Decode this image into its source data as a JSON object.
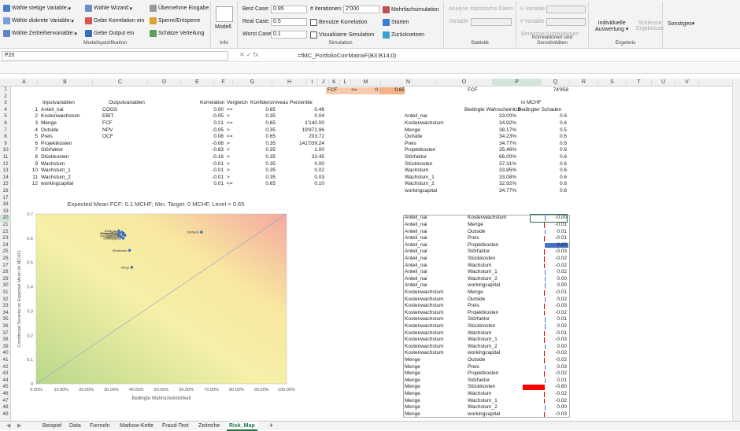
{
  "ribbon": {
    "modell": {
      "stetige": "Wähle stetige Variable:",
      "diskrete": "Wähle diskrete Variable:",
      "zeitreihe": "Wähle Zeitreihenvariable:",
      "wizard": "Wähle Wizard:",
      "korrelation": "Gebe Korrelation ein",
      "output": "Gebe Output ein",
      "uebernehme": "Übernehme Eingabe",
      "sperre": "Sperre/Entsperre",
      "schaetze": "Schätze Verteilung",
      "group_label": "Modellspezifikation"
    },
    "info": {
      "modell": "Modell",
      "group_label": "Info"
    },
    "simulation": {
      "best_label": "Best Case:",
      "best_value": "0.95",
      "real_label": "Real Case:",
      "real_value": "0.5",
      "worst_label": "Worst Case:",
      "worst_value": "0.1",
      "iter_label": "# Iterationen:",
      "iter_value": "2'000",
      "benutze": "Benutze Korrelation",
      "visualisiere": "Visualisiere Simulation",
      "mehrfach": "Mehrfachsimulation",
      "starten": "Starten",
      "zurueck": "Zurücksetzen",
      "group_label": "Simulation"
    },
    "statistik": {
      "analyse": "Analyse statistische Daten",
      "variable": "Variable",
      "group_label": "Statistik"
    },
    "korr": {
      "xvar": "X-Variable",
      "yvar": "Y-Variable",
      "berechne": "Berechne Korrelationen",
      "group_label": "Korrelationen und Sensitivitäten"
    },
    "ergebnis": {
      "individuelle": "Individuelle",
      "auswertung": "Auswertung",
      "schliesse": "Schliesse",
      "ergebnisse": "Ergebnisse",
      "group_label": "Ergebnis"
    },
    "sonstiges": {
      "label": "Sonstiges"
    }
  },
  "formula": {
    "namebox": "P20",
    "fx": "fx",
    "content": "=fMC_PortfolioCorrMatrixF(B3:B14;0)"
  },
  "columns": [
    "A",
    "B",
    "C",
    "D",
    "E",
    "F",
    "G",
    "H",
    "I",
    "J",
    "K",
    "L",
    "M",
    "N",
    "O",
    "P",
    "Q",
    "R",
    "S",
    "T",
    "U",
    "V"
  ],
  "rows": [
    "1",
    "2",
    "3",
    "4",
    "5",
    "6",
    "7",
    "8",
    "9",
    "10",
    "11",
    "12",
    "13",
    "14",
    "15",
    "16",
    "17",
    "18",
    "19",
    "20",
    "21",
    "22",
    "23",
    "24",
    "25",
    "26",
    "27",
    "28",
    "29",
    "30",
    "31",
    "32",
    "33",
    "34",
    "35",
    "36",
    "37",
    "38",
    "39",
    "40",
    "41",
    "42",
    "43",
    "44",
    "45",
    "46",
    "47",
    "48",
    "49"
  ],
  "fcf_box": {
    "label": "FCF",
    "op": "<=",
    "value": "0",
    "m": "0.65"
  },
  "table1": {
    "headers": [
      "Inputvariablen",
      "Outputvariablen",
      "Korrelation",
      "Vergleich",
      "Konfidenzniveau",
      "Perzentile"
    ],
    "rows": [
      [
        "1",
        "Anteil_nai",
        "COGS",
        "0.00",
        "<=",
        "0.65",
        "0.46"
      ],
      [
        "2",
        "Kostenwachstum",
        "EBIT",
        "-0.05",
        ">",
        "0.35",
        "0.04"
      ],
      [
        "3",
        "Menge",
        "FCF",
        "0.21",
        "<=",
        "0.65",
        "1'140.00"
      ],
      [
        "4",
        "Outside",
        "NPV",
        "-0.05",
        ">",
        "0.35",
        "19'872.96"
      ],
      [
        "5",
        "Preis",
        "OCF",
        "0.08",
        "<=",
        "0.65",
        "203.72"
      ],
      [
        "6",
        "Projektkosten",
        "",
        "-0.06",
        ">",
        "0.35",
        "141'039.24"
      ],
      [
        "7",
        "Störfaktor",
        "",
        "-0.83",
        ">",
        "0.35",
        "1.00"
      ],
      [
        "8",
        "Stückkosten",
        "",
        "-0.16",
        ">",
        "0.35",
        "33.45"
      ],
      [
        "9",
        "Wachstum",
        "",
        "-0.01",
        ">",
        "0.35",
        "0.00"
      ],
      [
        "10",
        "Wachstum_1",
        "",
        "-0.01",
        ">",
        "0.35",
        "0.02"
      ],
      [
        "11",
        "Wachstum_2",
        "",
        "-0.01",
        ">",
        "0.35",
        "0.03"
      ],
      [
        "12",
        "workingcapital",
        "",
        "0.01",
        "<=",
        "0.65",
        "0.10"
      ]
    ]
  },
  "table2": {
    "fcf_label": "FCF",
    "fcf_value": "74'958",
    "unit": "in MCHF",
    "h1": "Bedingte Wahrscheinlich",
    "h2": "Bedingter Schaden",
    "rows": [
      [
        "Anteil_nai",
        "33.00%",
        "0.6"
      ],
      [
        "Kostenwachstum",
        "34.92%",
        "0.6"
      ],
      [
        "Menge",
        "38.17%",
        "0.5"
      ],
      [
        "Outside",
        "34.23%",
        "0.6"
      ],
      [
        "Preis",
        "34.77%",
        "0.6"
      ],
      [
        "Projektkosten",
        "35.46%",
        "0.6"
      ],
      [
        "Störfaktor",
        "66.00%",
        "0.6"
      ],
      [
        "Stückkosten",
        "37.31%",
        "0.6"
      ],
      [
        "Wachstum",
        "33.85%",
        "0.6"
      ],
      [
        "Wachstum_1",
        "33.08%",
        "0.6"
      ],
      [
        "Wachstum_2",
        "32.92%",
        "0.6"
      ],
      [
        "workingcapital",
        "34.77%",
        "0.6"
      ]
    ]
  },
  "corr_list": [
    [
      "Anteil_nai",
      "Kostenwachstum",
      "-0.00"
    ],
    [
      "Anteil_nai",
      "Menge",
      "-0.01"
    ],
    [
      "Anteil_nai",
      "Outside",
      "0.01"
    ],
    [
      "Anteil_nai",
      "Preis",
      "-0.01"
    ],
    [
      "Anteil_nai",
      "Projektkosten",
      "0.65"
    ],
    [
      "Anteil_nai",
      "Störfaktor",
      "-0.03"
    ],
    [
      "Anteil_nai",
      "Stückkosten",
      "-0.02"
    ],
    [
      "Anteil_nai",
      "Wachstum",
      "-0.02"
    ],
    [
      "Anteil_nai",
      "Wachstum_1",
      "0.02"
    ],
    [
      "Anteil_nai",
      "Wachstum_2",
      "0.00"
    ],
    [
      "Anteil_nai",
      "workingcapital",
      "0.00"
    ],
    [
      "Kostenwachstum",
      "Menge",
      "-0.01"
    ],
    [
      "Kostenwachstum",
      "Outside",
      "0.02"
    ],
    [
      "Kostenwachstum",
      "Preis",
      "-0.03"
    ],
    [
      "Kostenwachstum",
      "Projektkosten",
      "-0.02"
    ],
    [
      "Kostenwachstum",
      "Störfaktor",
      "0.01"
    ],
    [
      "Kostenwachstum",
      "Stückkosten",
      "0.02"
    ],
    [
      "Kostenwachstum",
      "Wachstum",
      "-0.01"
    ],
    [
      "Kostenwachstum",
      "Wachstum_1",
      "-0.03"
    ],
    [
      "Kostenwachstum",
      "Wachstum_2",
      "0.00"
    ],
    [
      "Kostenwachstum",
      "workingcapital",
      "-0.02"
    ],
    [
      "Menge",
      "Outside",
      "-0.02"
    ],
    [
      "Menge",
      "Preis",
      "0.03"
    ],
    [
      "Menge",
      "Projektkosten",
      "-0.02"
    ],
    [
      "Menge",
      "Störfaktor",
      "0.01"
    ],
    [
      "Menge",
      "Stückkosten",
      "-0.60"
    ],
    [
      "Menge",
      "Wachstum",
      "-0.02"
    ],
    [
      "Menge",
      "Wachstum_1",
      "-0.02"
    ],
    [
      "Menge",
      "Wachstum_2",
      "0.00"
    ],
    [
      "Menge",
      "workingcapital",
      "-0.03"
    ]
  ],
  "chart_data": {
    "type": "scatter",
    "title": "Expected Mean FCF: 0.1 MCHF; Min. Target: 0 MCHF, Level = 0.65",
    "xlabel": "Bedingte Wahrscheinlichkeit",
    "ylabel": "Conditional Severity on Expected Mean (in MCHF)",
    "xlim": [
      0,
      1
    ],
    "ylim": [
      0,
      0.7
    ],
    "xticks": [
      "0.00%",
      "10.00%",
      "20.00%",
      "30.00%",
      "40.00%",
      "50.00%",
      "60.00%",
      "70.00%",
      "80.00%",
      "90.00%",
      "100.00%"
    ],
    "yticks": [
      "0",
      "0.1",
      "0.2",
      "0.3",
      "0.4",
      "0.5",
      "0.6",
      "0.7"
    ],
    "points": [
      {
        "label": "Anteil_nai",
        "x": 0.33,
        "y": 0.63
      },
      {
        "label": "Kostenwachstum",
        "x": 0.349,
        "y": 0.62
      },
      {
        "label": "Menge",
        "x": 0.3817,
        "y": 0.48
      },
      {
        "label": "Outside",
        "x": 0.3423,
        "y": 0.625
      },
      {
        "label": "Preis",
        "x": 0.3477,
        "y": 0.615
      },
      {
        "label": "Projektkosten",
        "x": 0.3546,
        "y": 0.612
      },
      {
        "label": "Störfaktor",
        "x": 0.66,
        "y": 0.625
      },
      {
        "label": "Stückkosten",
        "x": 0.3731,
        "y": 0.55
      },
      {
        "label": "Wachstum",
        "x": 0.3385,
        "y": 0.605
      },
      {
        "label": "Wachstum_1",
        "x": 0.3308,
        "y": 0.62
      },
      {
        "label": "Wachstum_2",
        "x": 0.3292,
        "y": 0.61
      },
      {
        "label": "workingcapital",
        "x": 0.3477,
        "y": 0.6
      }
    ],
    "diagonal": true,
    "colors": {
      "point": "#3f6fbf",
      "diag": "#8aa3c8"
    }
  },
  "sheet_tabs": [
    "Beispiel",
    "Data",
    "Formeln",
    "Markow-Kette",
    "Fraud-Test",
    "Zeitreihe",
    "Risk_Map"
  ],
  "active_tab": "Risk_Map",
  "add_tab": "+"
}
